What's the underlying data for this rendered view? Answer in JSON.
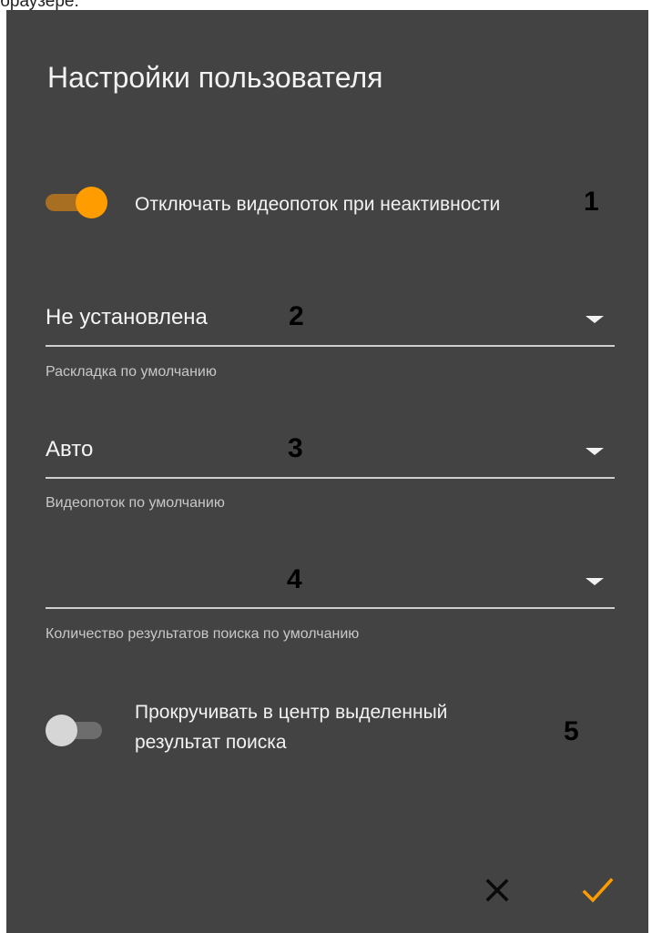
{
  "page": {
    "top_text": "браузере:"
  },
  "dialog": {
    "title": "Настройки пользователя",
    "toggle_inactivity": {
      "label": "Отключать видеопоток при неактивности",
      "checked": true,
      "marker": "1"
    },
    "layout_select": {
      "value": "Не установлена",
      "helper": "Раскладка по умолчанию",
      "marker": "2"
    },
    "stream_select": {
      "value": "Авто",
      "helper": "Видеопоток по умолчанию",
      "marker": "3"
    },
    "results_select": {
      "value": "",
      "helper": "Количество результатов поиска по умолчанию",
      "marker": "4"
    },
    "toggle_scroll": {
      "label_line1": "Прокручивать в центр выделенный",
      "label_line2": "результат поиска",
      "checked": false,
      "marker": "5"
    },
    "actions": {
      "cancel_icon": "close-icon",
      "confirm_icon": "check-icon"
    }
  },
  "colors": {
    "background": "#434343",
    "accent": "#ff9c00",
    "text": "#f2f2f2"
  }
}
